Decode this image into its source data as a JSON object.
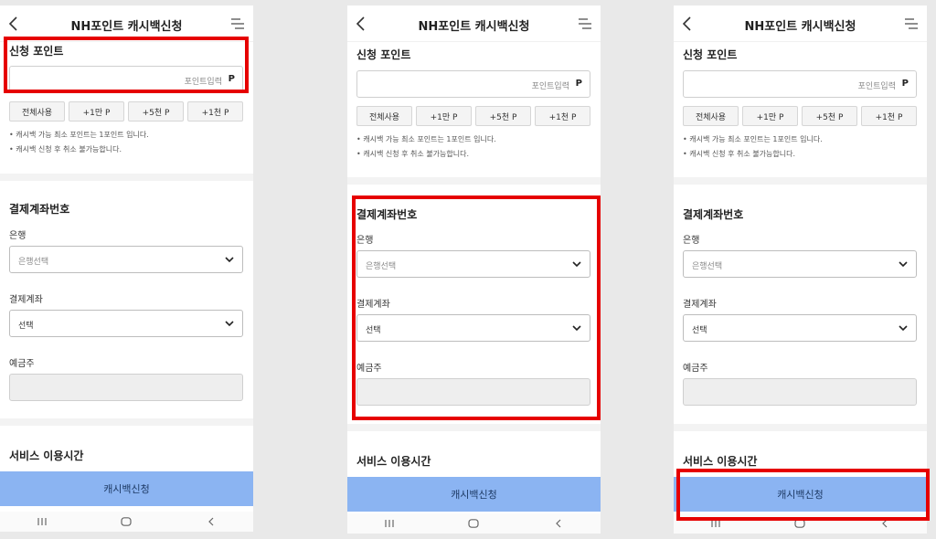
{
  "header": {
    "title": "NH포인트 캐시백신청"
  },
  "points": {
    "section_title": "신청 포인트",
    "input_placeholder": "포인트입력",
    "unit": "P",
    "quick_buttons": [
      "전체사용",
      "+1만 P",
      "+5천 P",
      "+1천 P"
    ],
    "notes": [
      "•  캐시백 가능 최소 포인트는 1포인트 입니다.",
      "•  캐시백 신청 후 취소 불가능합니다."
    ]
  },
  "account": {
    "section_title": "결제계좌번호",
    "bank_label": "은행",
    "bank_placeholder": "은행선택",
    "account_label": "결제계좌",
    "account_placeholder": "선택",
    "holder_label": "예금주"
  },
  "service": {
    "section_title": "서비스 이용시간"
  },
  "cta": {
    "label": "캐시백신청"
  },
  "colors": {
    "highlight": "#e60000",
    "cta_bg": "#8bb4f2"
  }
}
